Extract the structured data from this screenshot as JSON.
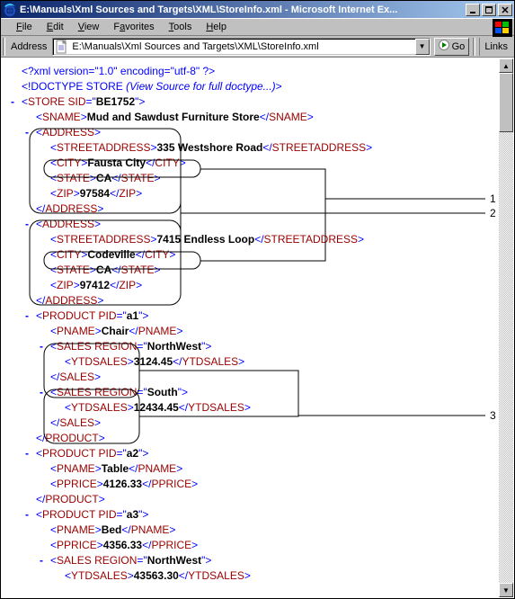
{
  "window": {
    "title": "E:\\Manuals\\Xml Sources and Targets\\XML\\StoreInfo.xml - Microsoft Internet Ex..."
  },
  "menu": {
    "file": "File",
    "edit": "Edit",
    "view": "View",
    "favorites": "Favorites",
    "tools": "Tools",
    "help": "Help"
  },
  "addressbar": {
    "label": "Address",
    "value": "E:\\Manuals\\Xml Sources and Targets\\XML\\StoreInfo.xml",
    "go": "Go",
    "links": "Links"
  },
  "xml": {
    "pi": "<?xml version=\"1.0\" encoding=\"utf-8\" ?>",
    "doctype_open": "<!DOCTYPE STORE ",
    "doctype_note": "(View Source for full doctype...)",
    "doctype_close": ">",
    "store_open": "STORE",
    "store_attr": "SID",
    "store_attr_val": "BE1752",
    "sname_tag": "SNAME",
    "sname_val": "Mud and Sawdust Furniture Store",
    "address_tag": "ADDRESS",
    "street_tag": "STREETADDRESS",
    "city_tag": "CITY",
    "state_tag": "STATE",
    "zip_tag": "ZIP",
    "addr1": {
      "street": "335 Westshore Road",
      "city": "Fausta City",
      "state": "CA",
      "zip": "97584"
    },
    "addr2": {
      "street": "7415 Endless Loop",
      "city": "Codeville",
      "state": "CA",
      "zip": "97412"
    },
    "product_tag": "PRODUCT",
    "pid_attr": "PID",
    "pname_tag": "PNAME",
    "sales_tag": "SALES",
    "region_attr": "REGION",
    "ytd_tag": "YTDSALES",
    "pprice_tag": "PPRICE",
    "p1": {
      "pid": "a1",
      "pname": "Chair",
      "s1_region": "NorthWest",
      "s1_ytd": "3124.45",
      "s2_region": "South",
      "s2_ytd": "12434.45"
    },
    "p2": {
      "pid": "a2",
      "pname": "Table",
      "pprice": "4126.33"
    },
    "p3": {
      "pid": "a3",
      "pname": "Bed",
      "pprice": "4356.33",
      "s1_region": "NorthWest",
      "s1_ytd": "43563.30"
    }
  },
  "callouts": {
    "c1": "1",
    "c2": "2",
    "c3": "3"
  }
}
